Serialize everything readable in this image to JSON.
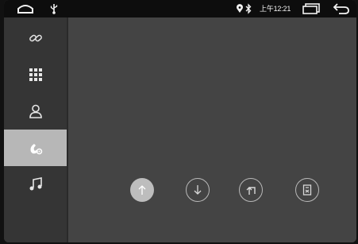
{
  "statusbar": {
    "time": "上午12:21",
    "icons": [
      "home-icon",
      "usb-icon",
      "location-icon",
      "bluetooth-icon",
      "recent-windows-icon",
      "back-icon"
    ]
  },
  "sidebar": {
    "items": [
      {
        "icon": "link-icon",
        "active": false
      },
      {
        "icon": "dialpad-icon",
        "active": false
      },
      {
        "icon": "contact-icon",
        "active": false
      },
      {
        "icon": "phone-settings-icon",
        "active": true
      },
      {
        "icon": "music-icon",
        "active": false
      }
    ]
  },
  "controls": [
    {
      "icon": "upload-icon",
      "style": "filled"
    },
    {
      "icon": "download-icon",
      "style": "outline"
    },
    {
      "icon": "return-icon",
      "style": "outline"
    },
    {
      "icon": "delete-icon",
      "style": "outline"
    }
  ],
  "colors": {
    "background": "#444444",
    "sidebar": "#353535",
    "active_item": "#b7b7b7",
    "statusbar": "#0d0d0d",
    "icon": "#e6e6e6"
  }
}
